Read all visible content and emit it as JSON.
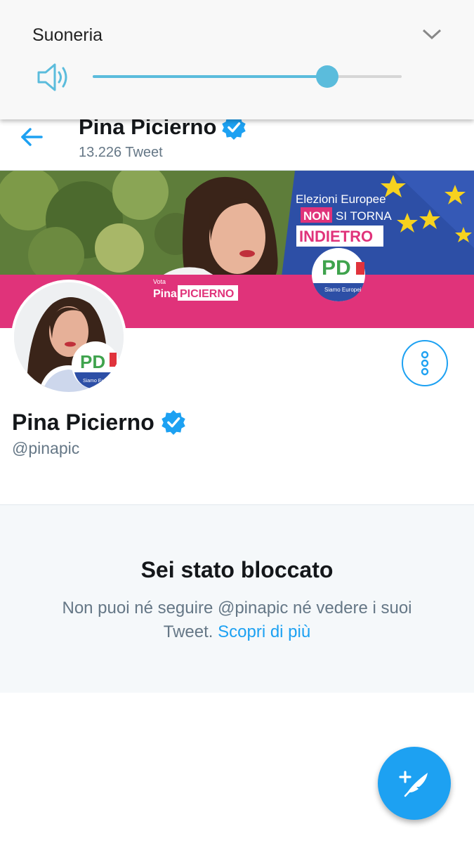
{
  "volume": {
    "title": "Suoneria",
    "level": 0.76,
    "accent_color": "#5bbcdc",
    "icons": {
      "speaker": "speaker-icon",
      "expand": "chevron-down-icon"
    }
  },
  "header": {
    "name": "Pina Picierno",
    "tweet_count": "13.226 Tweet",
    "icons": {
      "back": "arrow-left-icon",
      "verified": "verified-badge-icon"
    }
  },
  "banner": {
    "line1": "Elezioni Europee",
    "line2_a": "NON",
    "line2_b": "SI TORNA",
    "line3": "INDIETRO",
    "vota": "Vota",
    "pina": "Pina",
    "surname": "PICIERNO",
    "party_logo": "PD",
    "party_subtitle": "Siamo Europei",
    "colors": {
      "pink": "#e0337a",
      "eu_blue": "#2d4fa6",
      "star": "#f6d21f"
    }
  },
  "profile": {
    "name": "Pina Picierno",
    "handle": "@pinapic",
    "avatar_logo": "PD",
    "avatar_subtitle": "Siamo Europei"
  },
  "blocked": {
    "title": "Sei stato bloccato",
    "message": "Non puoi né seguire @pinapic né vedere i suoi Tweet. ",
    "link": "Scopri di più"
  },
  "fab": {
    "icon": "compose-tweet-icon"
  },
  "theme": {
    "accent": "#1da1f2",
    "secondary_text": "#657786"
  }
}
